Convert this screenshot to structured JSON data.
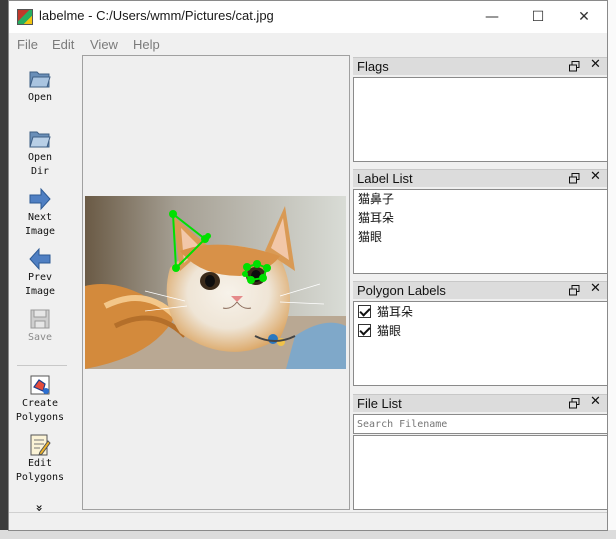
{
  "window": {
    "title": "labelme - C:/Users/wmm/Pictures/cat.jpg",
    "min_glyph": "—",
    "max_glyph": "☐",
    "close_glyph": "✕"
  },
  "menu": [
    "File",
    "Edit",
    "View",
    "Help"
  ],
  "toolbar": {
    "open": "Open",
    "open_dir": "Open\nDir",
    "next_image": "Next\nImage",
    "prev_image": "Prev\nImage",
    "save": "Save",
    "create_polygons": "Create\nPolygons",
    "edit_polygons": "Edit\nPolygons",
    "more_glyph": "»"
  },
  "docks": {
    "flags": {
      "title": "Flags"
    },
    "label_list": {
      "title": "Label List",
      "items": [
        "猫鼻子",
        "猫耳朵",
        "猫眼"
      ]
    },
    "polygon_labels": {
      "title": "Polygon Labels",
      "items": [
        "猫耳朵",
        "猫眼"
      ]
    },
    "file_list": {
      "title": "File List",
      "search_placeholder": "Search Filename"
    },
    "close_glyph": "✕"
  },
  "colors": {
    "polygon": "#00e000"
  },
  "icons": [
    "folder-open-icon",
    "folder-dir-icon",
    "arrow-right-icon",
    "arrow-left-icon",
    "floppy-icon",
    "create-polygon-icon",
    "edit-polygon-icon",
    "chevron-more-icon",
    "float-icon",
    "close-icon"
  ]
}
